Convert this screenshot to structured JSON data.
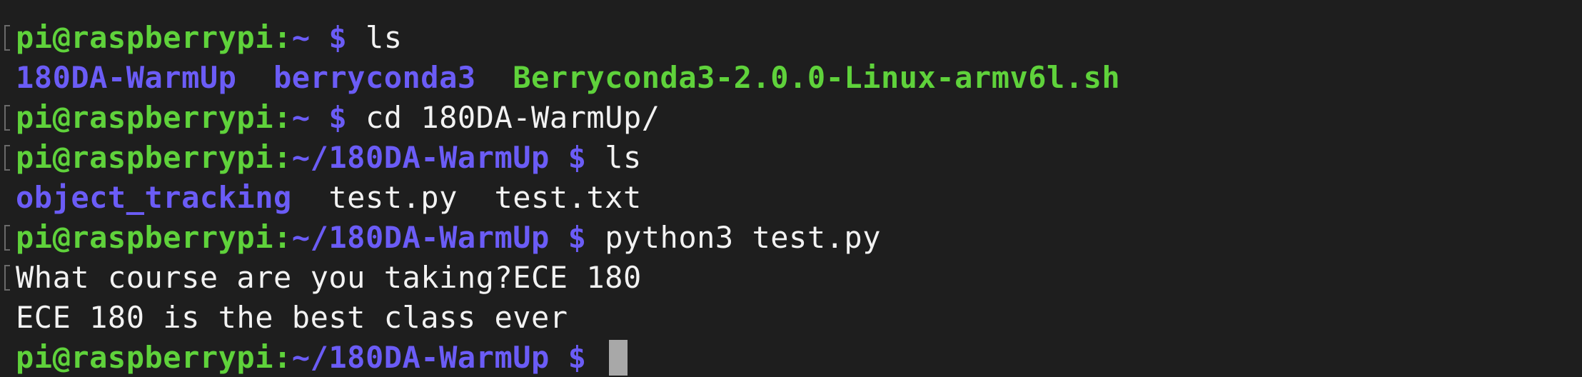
{
  "lines": [
    {
      "type": "prompt",
      "mark": true,
      "user": "pi@raspberrypi",
      "colon": ":",
      "path": "~",
      "dollar": " $ ",
      "command": "ls"
    },
    {
      "type": "listing",
      "mark": false,
      "items": [
        {
          "text": "180DA-WarmUp",
          "kind": "dir"
        },
        {
          "text": "  ",
          "kind": "sep"
        },
        {
          "text": "berryconda3",
          "kind": "dir"
        },
        {
          "text": "  ",
          "kind": "sep"
        },
        {
          "text": "Berryconda3-2.0.0-Linux-armv6l.sh",
          "kind": "exe"
        }
      ]
    },
    {
      "type": "prompt",
      "mark": true,
      "user": "pi@raspberrypi",
      "colon": ":",
      "path": "~",
      "dollar": " $ ",
      "command": "cd 180DA-WarmUp/"
    },
    {
      "type": "prompt",
      "mark": true,
      "user": "pi@raspberrypi",
      "colon": ":",
      "path": "~/180DA-WarmUp",
      "dollar": " $ ",
      "command": "ls"
    },
    {
      "type": "listing",
      "mark": false,
      "items": [
        {
          "text": "object_tracking",
          "kind": "dir"
        },
        {
          "text": "  ",
          "kind": "sep"
        },
        {
          "text": "test.py",
          "kind": "file"
        },
        {
          "text": "  ",
          "kind": "sep"
        },
        {
          "text": "test.txt",
          "kind": "file"
        }
      ]
    },
    {
      "type": "prompt",
      "mark": true,
      "user": "pi@raspberrypi",
      "colon": ":",
      "path": "~/180DA-WarmUp",
      "dollar": " $ ",
      "command": "python3 test.py"
    },
    {
      "type": "output",
      "mark": true,
      "text": "What course are you taking?ECE 180"
    },
    {
      "type": "output",
      "mark": false,
      "text": "ECE 180 is the best class ever"
    },
    {
      "type": "prompt",
      "mark": false,
      "user": "pi@raspberrypi",
      "colon": ":",
      "path": "~/180DA-WarmUp",
      "dollar": " $ ",
      "command": "",
      "cursor": true
    }
  ]
}
